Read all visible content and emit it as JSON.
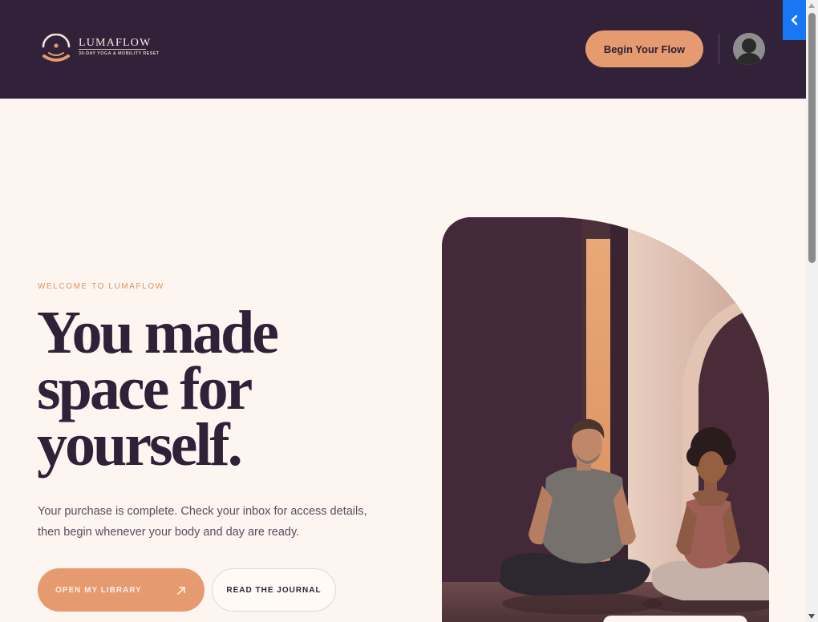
{
  "header": {
    "brand": {
      "name": "LUMAFLOW",
      "tagline": "30-DAY YOGA & MOBILITY RESET"
    },
    "cta_label": "Begin Your Flow",
    "avatar_icon": "user-silhouette-icon"
  },
  "side_toggle": {
    "icon": "chevron-left-icon",
    "color": "#1877f2"
  },
  "hero": {
    "eyebrow": "WELCOME TO LUMAFLOW",
    "headline": "You made space for yourself.",
    "body": "Your purchase is complete. Check your inbox for access details, then begin whenever your body and day are ready.",
    "primary_cta": {
      "label": "OPEN MY LIBRARY",
      "icon": "arrow-up-right-icon"
    },
    "secondary_cta": {
      "label": "READ THE JOURNAL"
    },
    "image_alt": "two-people-sitting-cross-legged-in-yoga-studio"
  },
  "colors": {
    "header_bg": "#31223a",
    "accent": "#e69a6f",
    "page_bg": "#fdf6f0",
    "heading": "#2f2138"
  }
}
